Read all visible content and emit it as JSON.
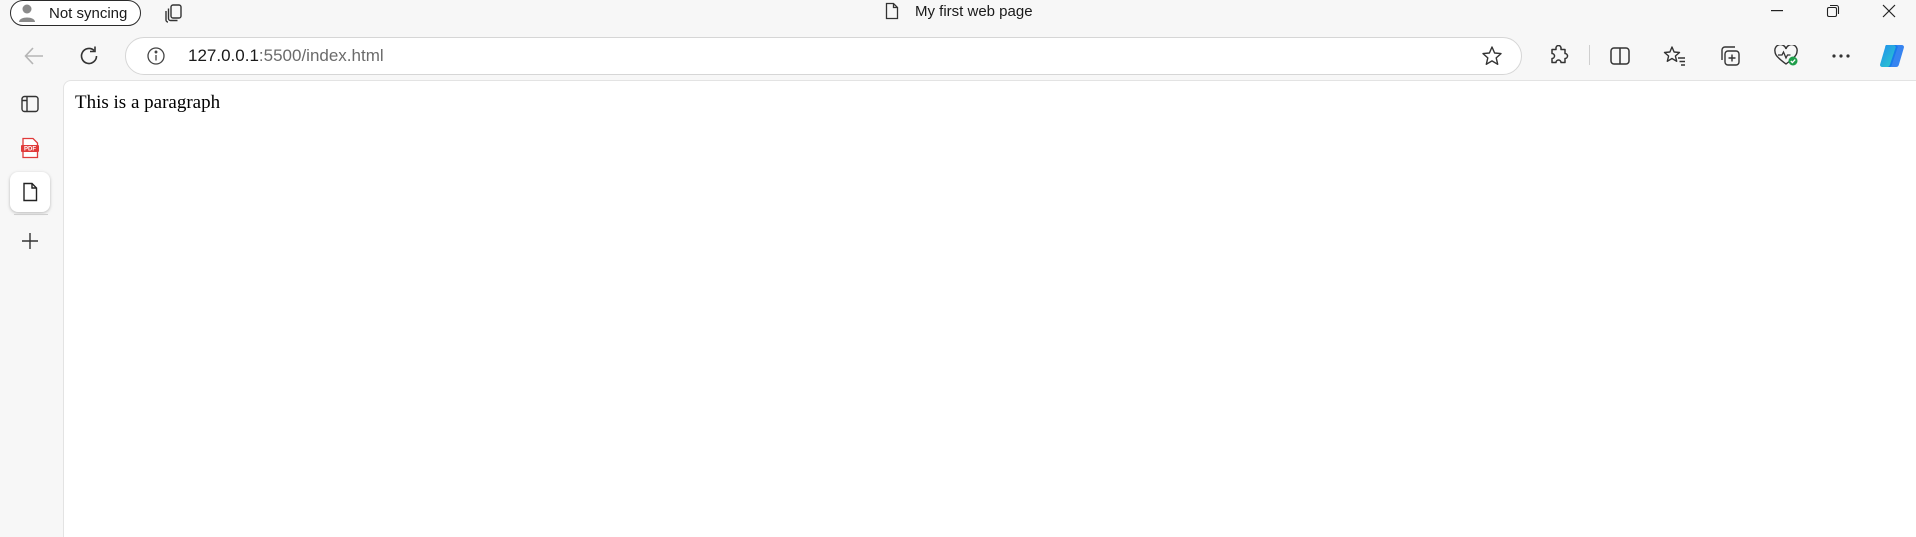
{
  "titlebar": {
    "profile_label": "Not syncing",
    "window_title": "My first web page"
  },
  "toolbar": {
    "url_host": "127.0.0.1",
    "url_path": ":5500/index.html"
  },
  "page": {
    "paragraph": "This is a paragraph"
  },
  "colors": {
    "copilot_gradient_start": "#1f8cf0",
    "copilot_gradient_end": "#2fd3c6",
    "pdf_red": "#e03a3a",
    "health_green": "#1e9e4a"
  },
  "icons": [
    "profile-icon",
    "workspaces-icon",
    "document-icon",
    "minimize-icon",
    "restore-icon",
    "close-icon",
    "back-icon",
    "refresh-icon",
    "site-info-icon",
    "favorite-star-icon",
    "extensions-icon",
    "split-screen-icon",
    "favorites-icon",
    "collections-icon",
    "browser-essentials-icon",
    "more-icon",
    "copilot-icon",
    "vertical-tabs-icon",
    "pdf-tab-icon",
    "page-tab-icon",
    "new-tab-icon"
  ]
}
